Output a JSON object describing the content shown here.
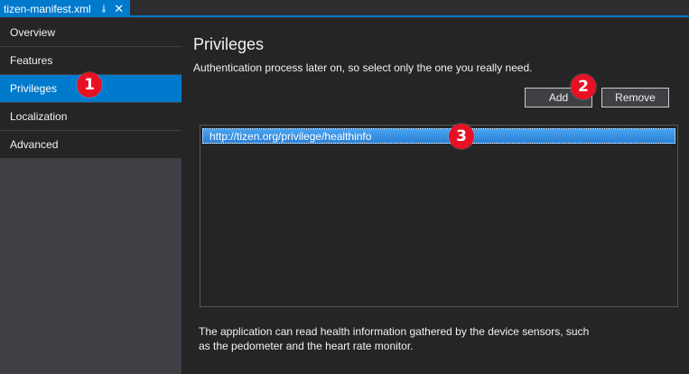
{
  "tab": {
    "title": "tizen-manifest.xml",
    "pin_icon": "⊸",
    "close_icon": "✕"
  },
  "nav": {
    "items": [
      {
        "label": "Overview"
      },
      {
        "label": "Features"
      },
      {
        "label": "Privileges"
      },
      {
        "label": "Localization"
      },
      {
        "label": "Advanced"
      }
    ],
    "selected": "Privileges"
  },
  "main": {
    "title": "Privileges",
    "description": "Authentication process later on, so select only the one you really need.",
    "add_label": "Add",
    "remove_label": "Remove",
    "privileges": [
      {
        "url": "http://tizen.org/privilege/healthinfo"
      }
    ],
    "help_text": "The application can read health information gathered by the device sensors, such as the pedometer and the heart rate monitor."
  },
  "callouts": {
    "one": "1",
    "two": "2",
    "three": "3"
  },
  "colors": {
    "accent": "#007acc",
    "callout": "#e81123",
    "selection": "#3399ff"
  }
}
